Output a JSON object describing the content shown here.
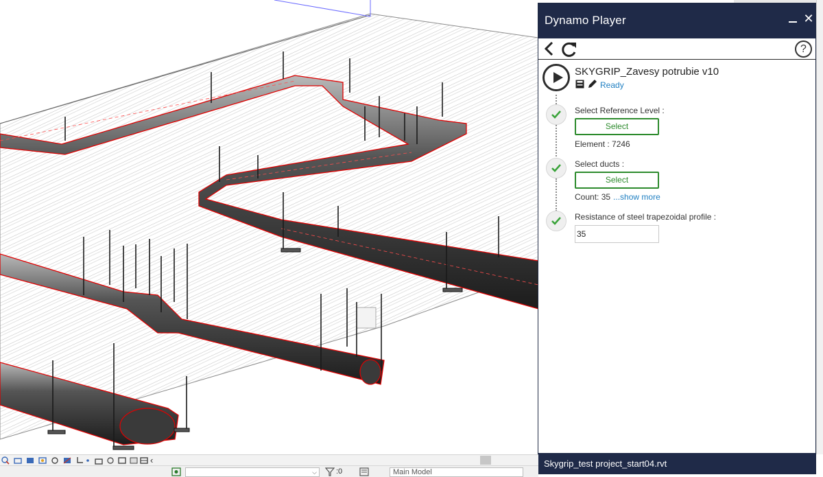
{
  "player": {
    "title": "Dynamo Player",
    "close_glyph": "✕",
    "help_glyph": "?",
    "script": {
      "name": "SKYGRIP_Zavesy potrubie v10",
      "status": "Ready"
    },
    "steps": [
      {
        "label": "Select Reference Level :",
        "button": "Select",
        "info": "Element : 7246"
      },
      {
        "label": "Select ducts :",
        "button": "Select",
        "info": "Count: 35",
        "show_more": "...show more"
      },
      {
        "label": "Resistance of steel trapezoidal profile :",
        "input_value": "35"
      }
    ],
    "footer_filename": "Skygrip_test project_start04.rvt"
  },
  "viewport": {
    "duct_outline_color": "#e00000",
    "duct_fill_color": "#2e2e2e",
    "deck_line_color": "#9a9a9a"
  },
  "status_bar": {
    "filter_count": ":0",
    "model_select": "Main Model",
    "dropdown_chevron": "⌵",
    "controlbar_chevron": "‹"
  },
  "icons": {
    "view_controls": [
      "scale-icon",
      "detail-level-icon",
      "visual-style-icon",
      "sun-path-icon",
      "shadows-icon",
      "render-icon",
      "crop-icon",
      "crop-region-icon",
      "unlock-3d-icon",
      "temporary-hide-icon",
      "reveal-hidden-icon",
      "temporary-properties-icon",
      "worksharing-icon",
      "analytical-icon"
    ]
  }
}
